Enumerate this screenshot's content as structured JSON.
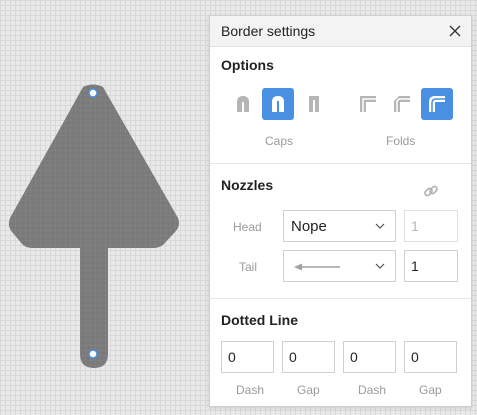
{
  "canvas": {
    "shape_fill": "#7a7a7a",
    "handle_fill": "#ffffff",
    "handle_stroke": "#4a90e2"
  },
  "panel": {
    "title": "Border settings",
    "close_icon": "close-icon"
  },
  "options": {
    "title": "Options",
    "caps_label": "Caps",
    "folds_label": "Folds",
    "caps": [
      {
        "icon": "cap-round-outer-icon",
        "active": false
      },
      {
        "icon": "cap-round-icon",
        "active": true
      },
      {
        "icon": "cap-square-icon",
        "active": false
      }
    ],
    "folds": [
      {
        "icon": "fold-miter-icon",
        "active": false
      },
      {
        "icon": "fold-bevel-icon",
        "active": false
      },
      {
        "icon": "fold-round-icon",
        "active": true
      }
    ],
    "accent": "#4a90e2"
  },
  "nozzles": {
    "title": "Nozzles",
    "link_icon": "link-icon",
    "head_label": "Head",
    "head_select": "Nope",
    "head_value": "1",
    "tail_label": "Tail",
    "tail_select_icon": "arrow-left-icon",
    "tail_value": "1"
  },
  "dotted": {
    "title": "Dotted Line",
    "fields": [
      {
        "value": "0",
        "label": "Dash"
      },
      {
        "value": "0",
        "label": "Gap"
      },
      {
        "value": "0",
        "label": "Dash"
      },
      {
        "value": "0",
        "label": "Gap"
      }
    ]
  }
}
